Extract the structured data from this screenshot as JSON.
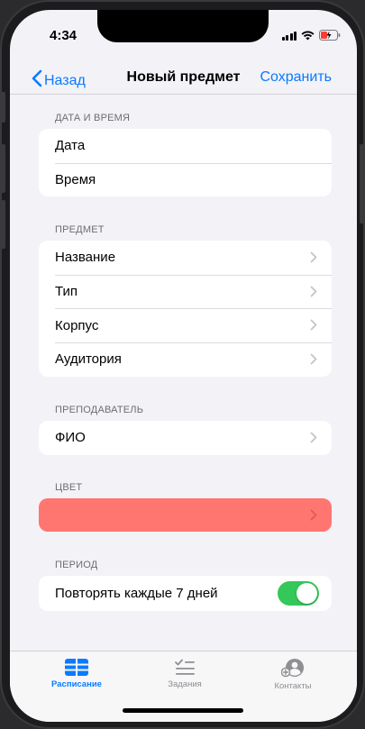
{
  "status_bar": {
    "time": "4:34",
    "icons": [
      "signal-icon",
      "wifi-icon",
      "battery-charging-icon"
    ]
  },
  "nav": {
    "back_label": "Назад",
    "title": "Новый предмет",
    "save_label": "Сохранить"
  },
  "sections": {
    "datetime": {
      "header": "ДАТА И ВРЕМЯ",
      "rows": [
        "Дата",
        "Время"
      ]
    },
    "subject": {
      "header": "ПРЕДМЕТ",
      "rows": [
        "Название",
        "Тип",
        "Корпус",
        "Аудитория"
      ]
    },
    "teacher": {
      "header": "ПРЕПОДАВАТЕЛЬ",
      "rows": [
        "ФИО"
      ]
    },
    "color": {
      "header": "ЦВЕТ",
      "value": "#ff7570"
    },
    "period": {
      "header": "ПЕРИОД",
      "repeat_label": "Повторять каждые 7 дней",
      "repeat_enabled": true
    }
  },
  "tabs": [
    {
      "label": "Расписание",
      "icon": "schedule-grid-icon",
      "active": true
    },
    {
      "label": "Задания",
      "icon": "checklist-icon",
      "active": false
    },
    {
      "label": "Контакты",
      "icon": "add-contact-icon",
      "active": false
    }
  ],
  "colors": {
    "accent": "#0a7aff",
    "toggle_on": "#34c759",
    "background": "#f2f2f7",
    "tab_inactive": "#8e8e93"
  }
}
